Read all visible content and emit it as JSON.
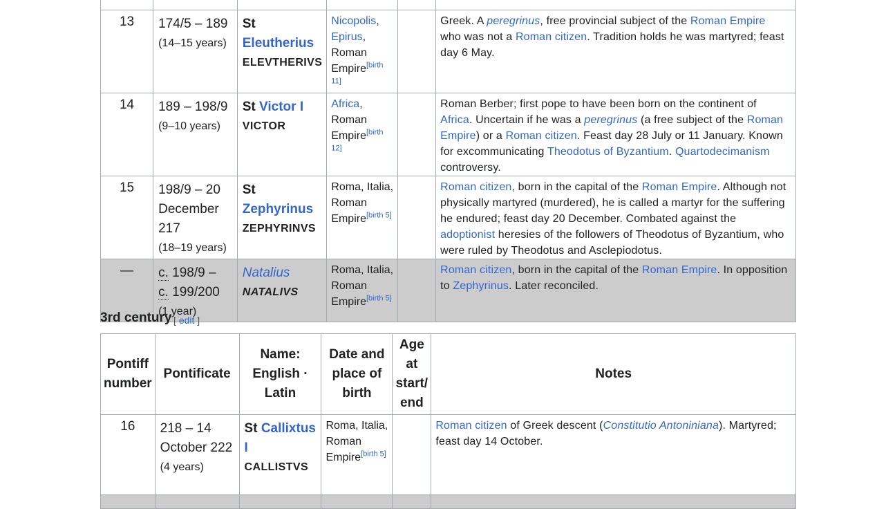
{
  "rows": [
    {
      "number": "13",
      "pontificate": "174/5 – 189",
      "years": "(14–15 years)",
      "st": "St",
      "name": "Eleutherius",
      "latin": "ELEVTHERIVS",
      "birth": [
        "Nicopolis",
        "Epirus",
        "Roman Empire"
      ],
      "birth_ref": "[birth 11]",
      "notes": {
        "p1": "Greek. A ",
        "peregrinus": "peregrinus",
        "p2": ", free provincial subject of the ",
        "roman_empire": "Roman Empire",
        "p3": " who was not a ",
        "roman_citizen": "Roman citizen",
        "p4": ". Tradition holds he was martyred; feast day 6 May."
      }
    },
    {
      "number": "14",
      "pontificate": "189 – 198/9",
      "years": "(9–10 years)",
      "st": "St",
      "name": "Victor I",
      "latin": "VICTOR",
      "birth": [
        "Africa",
        "Roman Empire"
      ],
      "birth_ref": "[birth 12]",
      "notes": {
        "p1": "Roman Berber; first pope to have been born on the continent of ",
        "africa": "Africa",
        "p2": ". Uncertain if he was a ",
        "peregrinus": "peregrinus",
        "p3": " (a free subject of the ",
        "roman_empire": "Roman Empire",
        "p4": ") or a ",
        "roman_citizen": "Roman citizen",
        "p5": ". Feast day 28 July or 11 January. Known for excommunicating ",
        "theodotus": "Theodotus of Byzantium",
        "p6": ". ",
        "quarto": "Quartodecimanism",
        "p7": " controversy."
      }
    },
    {
      "number": "15",
      "pontificate": "198/9 – 20 December 217",
      "years": "(18–19 years)",
      "st": "St",
      "name": "Zephyrinus",
      "latin": "ZEPHYRINVS",
      "birth": [
        "Roma, Italia,",
        "Roman Empire"
      ],
      "birth_ref": "[birth 5]",
      "notes": {
        "roman_citizen": "Roman citizen",
        "p1": ", born in the capital of the ",
        "roman_empire": "Roman Empire",
        "p2": ". Although not physically martyred (murdered), he is called a martyr for the suffering he endured; feast day 20 December. Combated against the ",
        "adoptionist": "adoptionist",
        "p3": " heresies of the followers of Theodotus of Byzantium, who were ruled by Theodotus and Asclepiodotus."
      }
    },
    {
      "number": "—",
      "pontificate_c1": "c.",
      "pontificate_v1": " 198/9 –",
      "pontificate_c2": "c.",
      "pontificate_v2": " 199/200",
      "years": "(1 year)",
      "name": "Natalius",
      "latin": "NATALIVS",
      "birth": [
        "Roma, Italia,",
        "Roman Empire"
      ],
      "birth_ref": "[birth 5]",
      "notes": {
        "roman_citizen": "Roman citizen",
        "p1": ", born in the capital of the ",
        "roman_empire": "Roman Empire",
        "p2": ". In opposition to ",
        "zephyrinus": "Zephyrinus",
        "p3": ". Later reconciled."
      }
    }
  ],
  "section": {
    "title": "3rd century",
    "edit_open": "[ ",
    "edit": "edit",
    "edit_close": " ]"
  },
  "headers": {
    "pontiff_number": "Pontiff number",
    "pontificate": "Pontificate",
    "name": "Name: English · Latin",
    "birth": "Date and place of birth",
    "age": "Age at start/ end",
    "notes": "Notes"
  },
  "row16": {
    "number": "16",
    "pontificate": "218 – 14 October 222",
    "years": "(4 years)",
    "st": "St",
    "name": "Callixtus I",
    "latin": "CALLISTVS",
    "birth": [
      "Roma, Italia,",
      "Roman Empire"
    ],
    "birth_ref": "[birth 5]",
    "notes": {
      "roman_citizen": "Roman citizen",
      "p1": " of Greek descent (",
      "constitutio": "Constitutio Antoniniana",
      "p2": "). Martyred; feast day 14 October."
    }
  }
}
